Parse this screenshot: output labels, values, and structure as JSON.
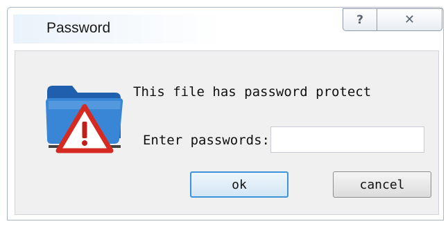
{
  "window": {
    "title": "Password",
    "help_glyph": "?",
    "close_glyph": "✕"
  },
  "dialog": {
    "message": "This file has password protect",
    "password_label": "Enter passwords:",
    "password_value": "",
    "ok_label": "ok",
    "cancel_label": "cancel",
    "icon": "warning-folder-icon"
  },
  "colors": {
    "ok_border": "#3c93d8",
    "warning_red": "#d42a22",
    "folder_blue": "#2d79cc"
  }
}
